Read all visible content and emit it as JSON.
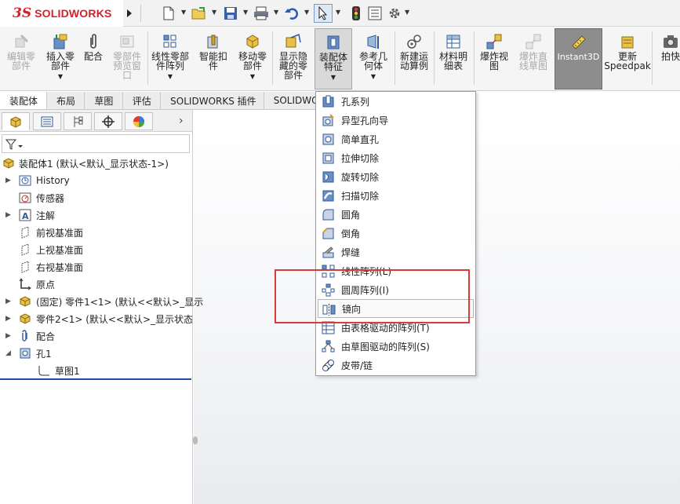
{
  "app": {
    "brand_ds": "3S",
    "brand": "SOLIDWORKS"
  },
  "toolbar": {
    "icons": [
      "new-document-icon",
      "open-icon",
      "save-icon",
      "print-icon",
      "undo-icon",
      "select-icon",
      "rebuild-icon",
      "file-properties-icon",
      "options-icon"
    ]
  },
  "ribbon": {
    "edit_component": "编辑零\n部件",
    "insert_components": "插入零\n部件",
    "mate": "配合",
    "component_preview": "零部件\n预览窗\n口",
    "linear_pattern": "线性零部\n件阵列",
    "smart_fasteners": "智能扣\n件",
    "move_component": "移动零\n部件",
    "show_hidden": "显示隐\n藏的零\n部件",
    "assembly_features": "装配体\n特征",
    "reference_geometry": "参考几\n何体",
    "new_motion_study": "新建运\n动算例",
    "bom": "材料明\n细表",
    "exploded_view": "爆炸视\n图",
    "explode_line_sketch": "爆炸直\n线草图",
    "instant3d": "Instant3D",
    "update_speedpak": "更新\nSpeedpak",
    "take_snapshot": "拍快"
  },
  "tabs": [
    "装配体",
    "布局",
    "草图",
    "评估",
    "SOLIDWORKS 插件",
    "SOLIDWO"
  ],
  "feature_tree": {
    "assembly": "装配体1 (默认<默认_显示状态-1>)",
    "history": "History",
    "sensors": "传感器",
    "annotations": "注解",
    "front_plane": "前视基准面",
    "top_plane": "上视基准面",
    "right_plane": "右视基准面",
    "origin": "原点",
    "part1": "(固定) 零件1<1> (默认<<默认>_显示",
    "part2": "零件2<1> (默认<<默认>_显示状态",
    "mates": "配合",
    "hole1": "孔1",
    "sketch1": "草图1"
  },
  "menu": {
    "items": [
      "孔系列",
      "异型孔向导",
      "简单直孔",
      "拉伸切除",
      "旋转切除",
      "扫描切除",
      "圆角",
      "倒角",
      "焊缝",
      "线性阵列(L)",
      "圆周阵列(I)",
      "镜向",
      "由表格驱动的阵列(T)",
      "由草图驱动的阵列(S)",
      "皮带/链"
    ],
    "highlighted_index": 11
  },
  "colors": {
    "brand_red": "#d4202b",
    "annotation_red": "#d93b3b",
    "tree_blue": "#1f4fa8"
  }
}
